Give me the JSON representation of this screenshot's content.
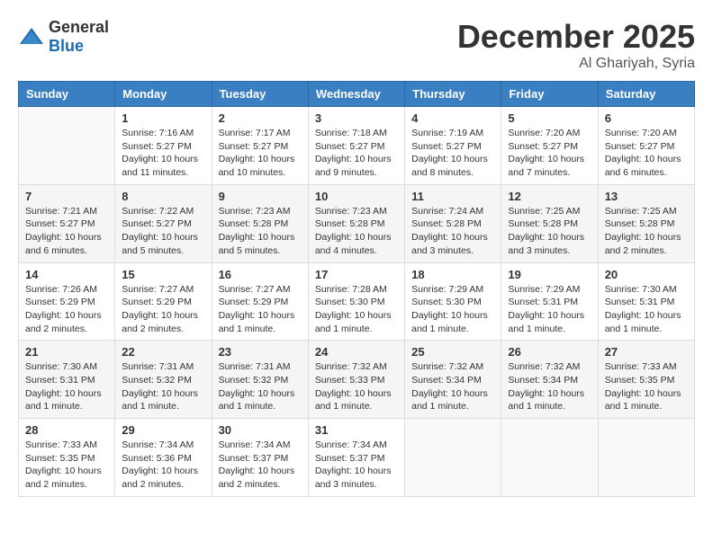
{
  "logo": {
    "general": "General",
    "blue": "Blue"
  },
  "header": {
    "month": "December 2025",
    "location": "Al Ghariyah, Syria"
  },
  "weekdays": [
    "Sunday",
    "Monday",
    "Tuesday",
    "Wednesday",
    "Thursday",
    "Friday",
    "Saturday"
  ],
  "weeks": [
    [
      {
        "day": "",
        "info": ""
      },
      {
        "day": "1",
        "info": "Sunrise: 7:16 AM\nSunset: 5:27 PM\nDaylight: 10 hours\nand 11 minutes."
      },
      {
        "day": "2",
        "info": "Sunrise: 7:17 AM\nSunset: 5:27 PM\nDaylight: 10 hours\nand 10 minutes."
      },
      {
        "day": "3",
        "info": "Sunrise: 7:18 AM\nSunset: 5:27 PM\nDaylight: 10 hours\nand 9 minutes."
      },
      {
        "day": "4",
        "info": "Sunrise: 7:19 AM\nSunset: 5:27 PM\nDaylight: 10 hours\nand 8 minutes."
      },
      {
        "day": "5",
        "info": "Sunrise: 7:20 AM\nSunset: 5:27 PM\nDaylight: 10 hours\nand 7 minutes."
      },
      {
        "day": "6",
        "info": "Sunrise: 7:20 AM\nSunset: 5:27 PM\nDaylight: 10 hours\nand 6 minutes."
      }
    ],
    [
      {
        "day": "7",
        "info": "Sunrise: 7:21 AM\nSunset: 5:27 PM\nDaylight: 10 hours\nand 6 minutes."
      },
      {
        "day": "8",
        "info": "Sunrise: 7:22 AM\nSunset: 5:27 PM\nDaylight: 10 hours\nand 5 minutes."
      },
      {
        "day": "9",
        "info": "Sunrise: 7:23 AM\nSunset: 5:28 PM\nDaylight: 10 hours\nand 5 minutes."
      },
      {
        "day": "10",
        "info": "Sunrise: 7:23 AM\nSunset: 5:28 PM\nDaylight: 10 hours\nand 4 minutes."
      },
      {
        "day": "11",
        "info": "Sunrise: 7:24 AM\nSunset: 5:28 PM\nDaylight: 10 hours\nand 3 minutes."
      },
      {
        "day": "12",
        "info": "Sunrise: 7:25 AM\nSunset: 5:28 PM\nDaylight: 10 hours\nand 3 minutes."
      },
      {
        "day": "13",
        "info": "Sunrise: 7:25 AM\nSunset: 5:28 PM\nDaylight: 10 hours\nand 2 minutes."
      }
    ],
    [
      {
        "day": "14",
        "info": "Sunrise: 7:26 AM\nSunset: 5:29 PM\nDaylight: 10 hours\nand 2 minutes."
      },
      {
        "day": "15",
        "info": "Sunrise: 7:27 AM\nSunset: 5:29 PM\nDaylight: 10 hours\nand 2 minutes."
      },
      {
        "day": "16",
        "info": "Sunrise: 7:27 AM\nSunset: 5:29 PM\nDaylight: 10 hours\nand 1 minute."
      },
      {
        "day": "17",
        "info": "Sunrise: 7:28 AM\nSunset: 5:30 PM\nDaylight: 10 hours\nand 1 minute."
      },
      {
        "day": "18",
        "info": "Sunrise: 7:29 AM\nSunset: 5:30 PM\nDaylight: 10 hours\nand 1 minute."
      },
      {
        "day": "19",
        "info": "Sunrise: 7:29 AM\nSunset: 5:31 PM\nDaylight: 10 hours\nand 1 minute."
      },
      {
        "day": "20",
        "info": "Sunrise: 7:30 AM\nSunset: 5:31 PM\nDaylight: 10 hours\nand 1 minute."
      }
    ],
    [
      {
        "day": "21",
        "info": "Sunrise: 7:30 AM\nSunset: 5:31 PM\nDaylight: 10 hours\nand 1 minute."
      },
      {
        "day": "22",
        "info": "Sunrise: 7:31 AM\nSunset: 5:32 PM\nDaylight: 10 hours\nand 1 minute."
      },
      {
        "day": "23",
        "info": "Sunrise: 7:31 AM\nSunset: 5:32 PM\nDaylight: 10 hours\nand 1 minute."
      },
      {
        "day": "24",
        "info": "Sunrise: 7:32 AM\nSunset: 5:33 PM\nDaylight: 10 hours\nand 1 minute."
      },
      {
        "day": "25",
        "info": "Sunrise: 7:32 AM\nSunset: 5:34 PM\nDaylight: 10 hours\nand 1 minute."
      },
      {
        "day": "26",
        "info": "Sunrise: 7:32 AM\nSunset: 5:34 PM\nDaylight: 10 hours\nand 1 minute."
      },
      {
        "day": "27",
        "info": "Sunrise: 7:33 AM\nSunset: 5:35 PM\nDaylight: 10 hours\nand 1 minute."
      }
    ],
    [
      {
        "day": "28",
        "info": "Sunrise: 7:33 AM\nSunset: 5:35 PM\nDaylight: 10 hours\nand 2 minutes."
      },
      {
        "day": "29",
        "info": "Sunrise: 7:34 AM\nSunset: 5:36 PM\nDaylight: 10 hours\nand 2 minutes."
      },
      {
        "day": "30",
        "info": "Sunrise: 7:34 AM\nSunset: 5:37 PM\nDaylight: 10 hours\nand 2 minutes."
      },
      {
        "day": "31",
        "info": "Sunrise: 7:34 AM\nSunset: 5:37 PM\nDaylight: 10 hours\nand 3 minutes."
      },
      {
        "day": "",
        "info": ""
      },
      {
        "day": "",
        "info": ""
      },
      {
        "day": "",
        "info": ""
      }
    ]
  ]
}
